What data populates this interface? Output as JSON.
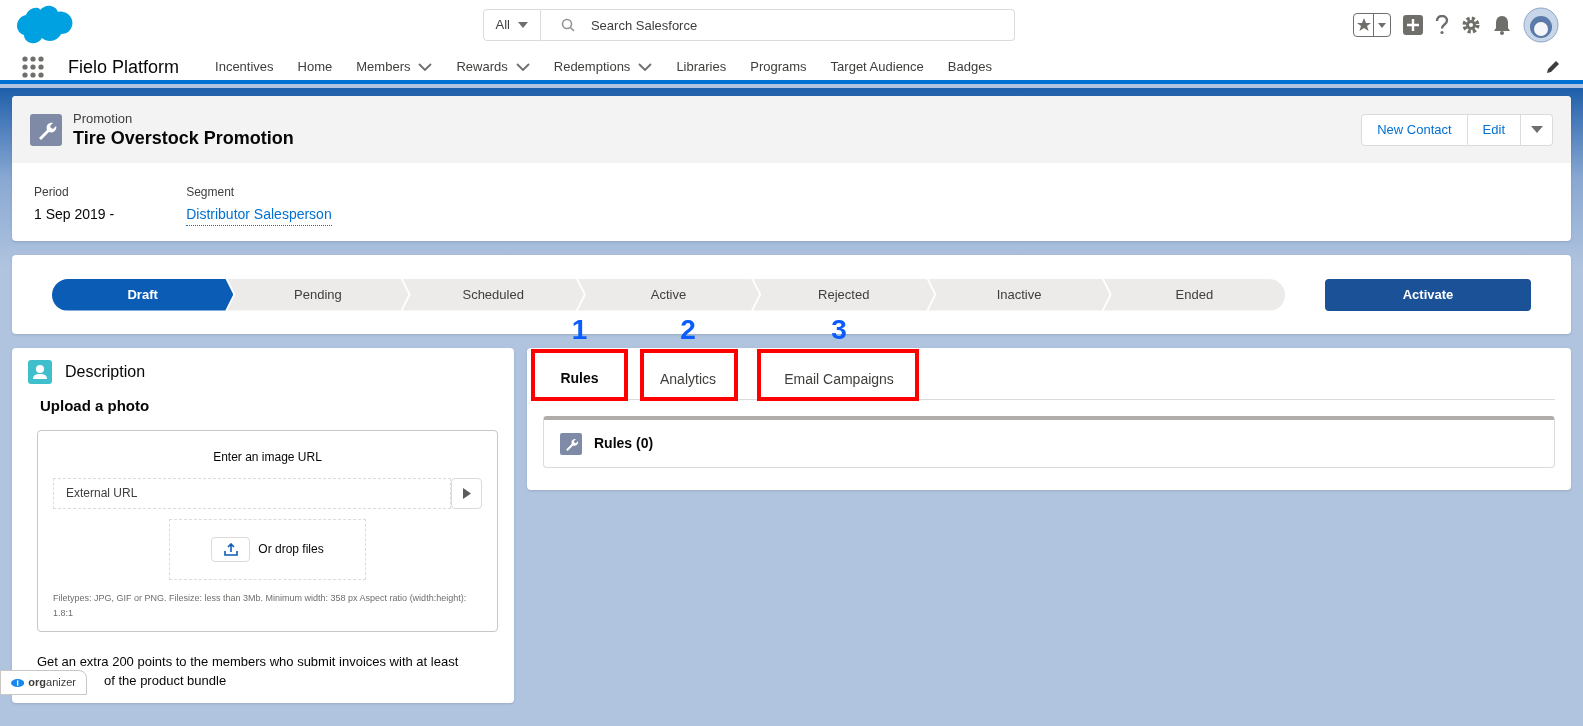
{
  "header": {
    "search": {
      "scope": "All",
      "placeholder": "Search Salesforce"
    },
    "app_name": "Fielo Platform",
    "nav": [
      {
        "label": "Incentives",
        "has_menu": false
      },
      {
        "label": "Home",
        "has_menu": false
      },
      {
        "label": "Members",
        "has_menu": true
      },
      {
        "label": "Rewards",
        "has_menu": true
      },
      {
        "label": "Redemptions",
        "has_menu": true
      },
      {
        "label": "Libraries",
        "has_menu": false
      },
      {
        "label": "Programs",
        "has_menu": false
      },
      {
        "label": "Target Audience",
        "has_menu": false
      },
      {
        "label": "Badges",
        "has_menu": false
      }
    ]
  },
  "record": {
    "object": "Promotion",
    "title": "Tire Overstock Promotion",
    "actions": [
      "New Contact",
      "Edit"
    ],
    "fields": [
      {
        "label": "Period",
        "value": "1 Sep 2019 -",
        "kind": "text"
      },
      {
        "label": "Segment",
        "value": "Distributor Salesperson",
        "kind": "link"
      }
    ]
  },
  "path": {
    "stages": [
      {
        "label": "Draft",
        "selected": true
      },
      {
        "label": "Pending",
        "selected": false
      },
      {
        "label": "Scheduled",
        "selected": false
      },
      {
        "label": "Active",
        "selected": false
      },
      {
        "label": "Rejected",
        "selected": false
      },
      {
        "label": "Inactive",
        "selected": false
      },
      {
        "label": "Ended",
        "selected": false
      }
    ],
    "action": "Activate"
  },
  "description": {
    "title": "Description",
    "upload_heading": "Upload a photo",
    "url_label": "Enter an image URL",
    "url_placeholder": "External URL",
    "drop_label": "Or drop files",
    "hint": "Filetypes: JPG, GIF or PNG. Filesize: less than 3Mb. Minimum width: 358 px Aspect ratio (width:height): 1.8:1",
    "text_lines": [
      "Get an extra 200 points to the members who submit invoices with at least",
      "of the product bundle"
    ]
  },
  "tabs": [
    {
      "label": "Rules",
      "selected": true,
      "annotation": "1"
    },
    {
      "label": "Analytics",
      "selected": false,
      "annotation": "2"
    },
    {
      "label": "Email Campaigns",
      "selected": false,
      "annotation": "3"
    }
  ],
  "related": {
    "title": "Rules (0)"
  },
  "organizer": {
    "bold": "org",
    "rest": "anizer"
  }
}
